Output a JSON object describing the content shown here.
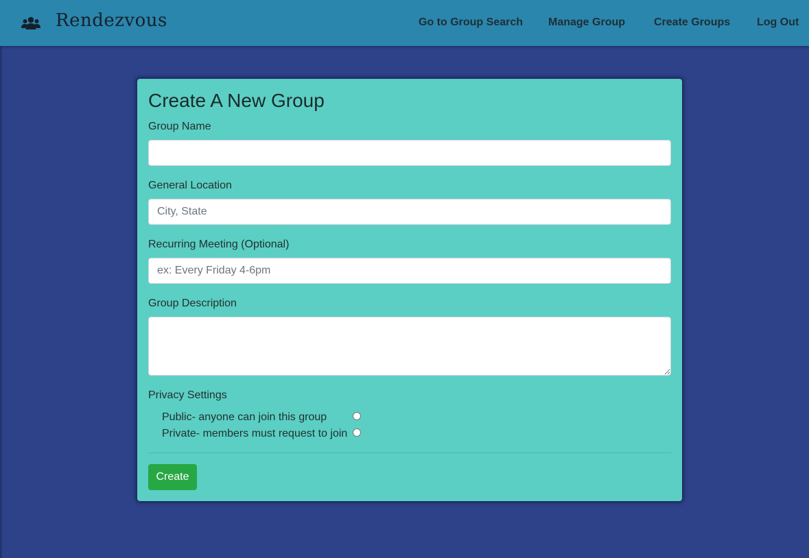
{
  "app": {
    "brand_name": "Rendezvous",
    "brand_icon": "users-icon"
  },
  "nav": {
    "group_search": "Go to Group Search",
    "manage_group": "Manage Group",
    "create_groups": "Create Groups",
    "log_out": "Log Out"
  },
  "form": {
    "title": "Create A New Group",
    "group_name": {
      "label": "Group Name",
      "value": "",
      "placeholder": ""
    },
    "location": {
      "label": "General Location",
      "value": "",
      "placeholder": "City, State"
    },
    "meeting": {
      "label": "Recurring Meeting (Optional)",
      "value": "",
      "placeholder": "ex: Every Friday 4-6pm"
    },
    "description": {
      "label": "Group Description",
      "value": "",
      "placeholder": ""
    },
    "privacy": {
      "label": "Privacy Settings",
      "options": [
        {
          "label": "Public- anyone can join this group",
          "selected": false
        },
        {
          "label": "Private- members must request to join",
          "selected": false
        }
      ]
    },
    "submit_label": "Create"
  },
  "colors": {
    "navbar": "#2a86ad",
    "background": "#2e4289",
    "card": "#5bcfc4",
    "button": "#28a745"
  }
}
